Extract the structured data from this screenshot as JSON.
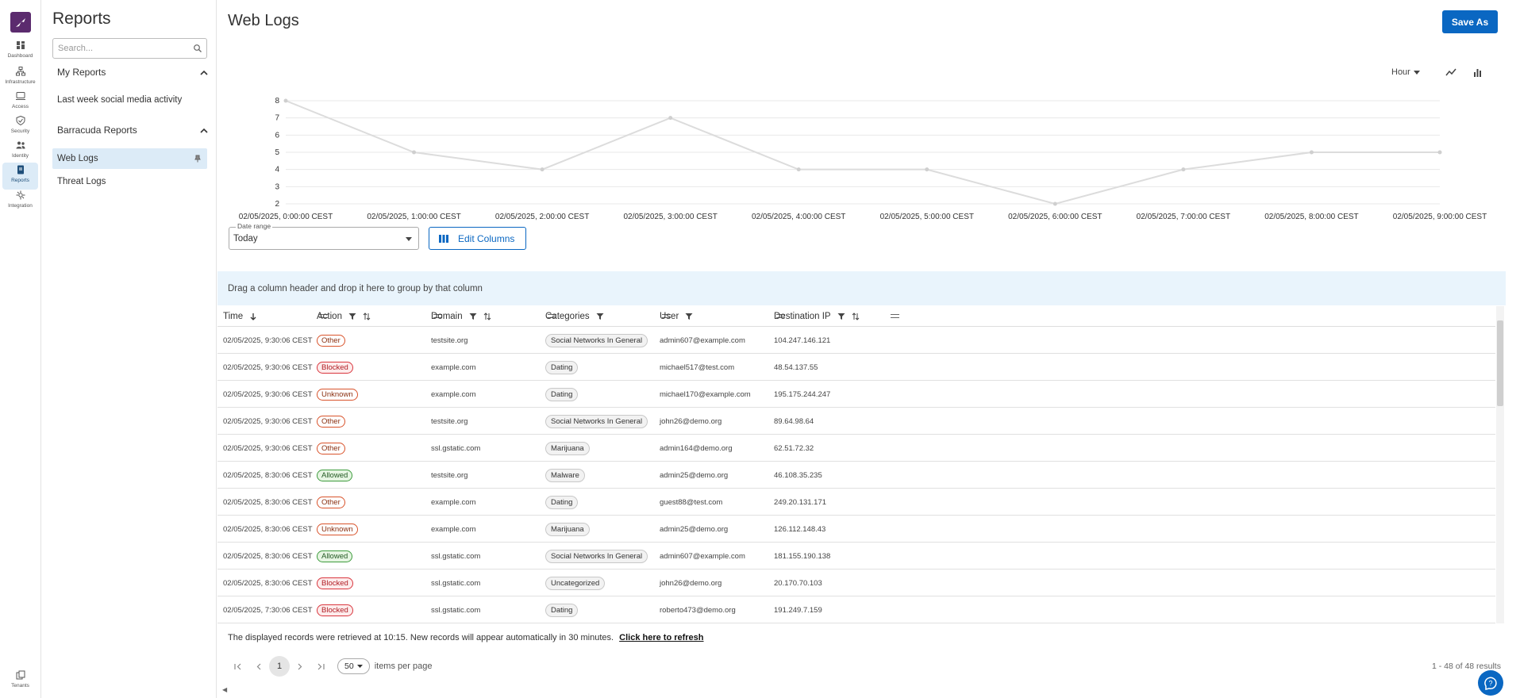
{
  "nav": {
    "items": [
      {
        "label": "Dashboard",
        "icon": "dashboard-icon"
      },
      {
        "label": "Infrastructure",
        "icon": "infrastructure-icon"
      },
      {
        "label": "Access",
        "icon": "access-icon"
      },
      {
        "label": "Security",
        "icon": "shield-icon"
      },
      {
        "label": "Identity",
        "icon": "identity-icon"
      },
      {
        "label": "Reports",
        "icon": "reports-icon",
        "active": true
      },
      {
        "label": "Integration",
        "icon": "integration-icon"
      }
    ],
    "bottom": {
      "label": "Tenants",
      "icon": "tenants-icon"
    }
  },
  "reports_panel": {
    "title": "Reports",
    "search_placeholder": "Search...",
    "sections": [
      {
        "title": "My Reports",
        "items": [
          "Last week social media activity"
        ]
      },
      {
        "title": "Barracuda Reports",
        "items": [
          "Web Logs",
          "Threat Logs"
        ]
      }
    ]
  },
  "header": {
    "title": "Web Logs",
    "save_label": "Save As"
  },
  "chart_controls": {
    "interval": "Hour"
  },
  "chart_data": {
    "type": "line",
    "x": [
      "02/05/2025, 0:00:00 CEST",
      "02/05/2025, 1:00:00 CEST",
      "02/05/2025, 2:00:00 CEST",
      "02/05/2025, 3:00:00 CEST",
      "02/05/2025, 4:00:00 CEST",
      "02/05/2025, 5:00:00 CEST",
      "02/05/2025, 6:00:00 CEST",
      "02/05/2025, 7:00:00 CEST",
      "02/05/2025, 8:00:00 CEST",
      "02/05/2025, 9:00:00 CEST"
    ],
    "series": [
      {
        "values": [
          8,
          5,
          4,
          7,
          4,
          4,
          2,
          4,
          5,
          5
        ]
      }
    ],
    "ylim": [
      2,
      8
    ],
    "yticks": [
      2,
      3,
      4,
      5,
      6,
      7,
      8
    ],
    "grid": true,
    "colors": {
      "line": "#dcdcdc",
      "grid": "#e8e8e8"
    }
  },
  "filters": {
    "date_range_label": "Date range",
    "date_range_value": "Today",
    "edit_columns_label": "Edit Columns"
  },
  "group_bar": "Drag a column header and drop it here to group by that column",
  "table": {
    "columns": [
      "Time",
      "Action",
      "Domain",
      "Categories",
      "User",
      "Destination IP"
    ],
    "rows": [
      [
        "02/05/2025, 9:30:06 CEST",
        "Other",
        "testsite.org",
        "Social Networks In General",
        "admin607@example.com",
        "104.247.146.121"
      ],
      [
        "02/05/2025, 9:30:06 CEST",
        "Blocked",
        "example.com",
        "Dating",
        "michael517@test.com",
        "48.54.137.55"
      ],
      [
        "02/05/2025, 9:30:06 CEST",
        "Unknown",
        "example.com",
        "Dating",
        "michael170@example.com",
        "195.175.244.247"
      ],
      [
        "02/05/2025, 9:30:06 CEST",
        "Other",
        "testsite.org",
        "Social Networks In General",
        "john26@demo.org",
        "89.64.98.64"
      ],
      [
        "02/05/2025, 9:30:06 CEST",
        "Other",
        "ssl.gstatic.com",
        "Marijuana",
        "admin164@demo.org",
        "62.51.72.32"
      ],
      [
        "02/05/2025, 8:30:06 CEST",
        "Allowed",
        "testsite.org",
        "Malware",
        "admin25@demo.org",
        "46.108.35.235"
      ],
      [
        "02/05/2025, 8:30:06 CEST",
        "Other",
        "example.com",
        "Dating",
        "guest88@test.com",
        "249.20.131.171"
      ],
      [
        "02/05/2025, 8:30:06 CEST",
        "Unknown",
        "example.com",
        "Marijuana",
        "admin25@demo.org",
        "126.112.148.43"
      ],
      [
        "02/05/2025, 8:30:06 CEST",
        "Allowed",
        "ssl.gstatic.com",
        "Social Networks In General",
        "admin607@example.com",
        "181.155.190.138"
      ],
      [
        "02/05/2025, 8:30:06 CEST",
        "Blocked",
        "ssl.gstatic.com",
        "Uncategorized",
        "john26@demo.org",
        "20.170.70.103"
      ],
      [
        "02/05/2025, 7:30:06 CEST",
        "Blocked",
        "ssl.gstatic.com",
        "Dating",
        "roberto473@demo.org",
        "191.249.7.159"
      ]
    ]
  },
  "footer": {
    "refresh_text": "The displayed records were retrieved at 10:15. New records will appear automatically in 30 minutes.",
    "refresh_link": "Click here to refresh",
    "page": "1",
    "per_page": "50",
    "items_per_page_label": "items per page",
    "results": "1 - 48 of 48 results"
  }
}
